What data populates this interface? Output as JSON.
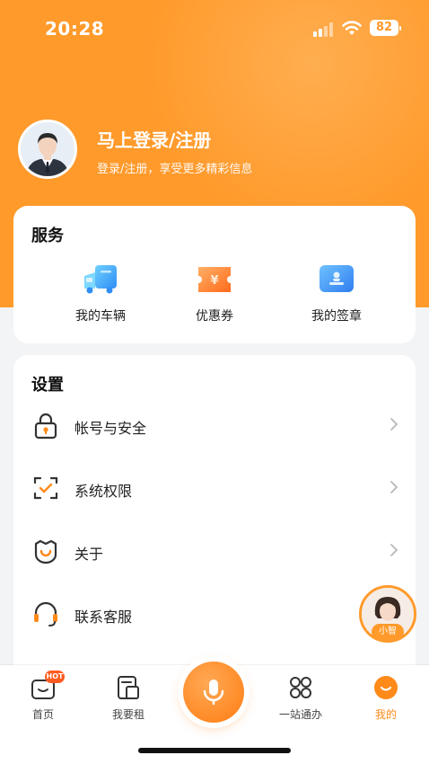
{
  "status_bar": {
    "time": "20:28",
    "battery": "82"
  },
  "profile": {
    "title": "马上登录/注册",
    "subtitle": "登录/注册，享受更多精彩信息"
  },
  "services": {
    "title": "服务",
    "items": [
      {
        "label": "我的车辆",
        "icon": "truck-icon"
      },
      {
        "label": "优惠券",
        "icon": "coupon-icon"
      },
      {
        "label": "我的签章",
        "icon": "seal-icon"
      }
    ]
  },
  "settings": {
    "title": "设置",
    "items": [
      {
        "label": "帐号与安全",
        "icon": "lock-icon"
      },
      {
        "label": "系统权限",
        "icon": "scan-check-icon"
      },
      {
        "label": "关于",
        "icon": "badge-check-icon"
      },
      {
        "label": "联系客服",
        "icon": "headset-icon"
      }
    ]
  },
  "assistant": {
    "tag": "小智"
  },
  "tabbar": {
    "items": [
      {
        "label": "首页",
        "badge": "HOT"
      },
      {
        "label": "我要租"
      },
      {
        "label": "一站通办"
      },
      {
        "label": "我的"
      }
    ]
  },
  "colors": {
    "accent": "#ff9a2b",
    "accent_dark": "#ff7d12"
  }
}
